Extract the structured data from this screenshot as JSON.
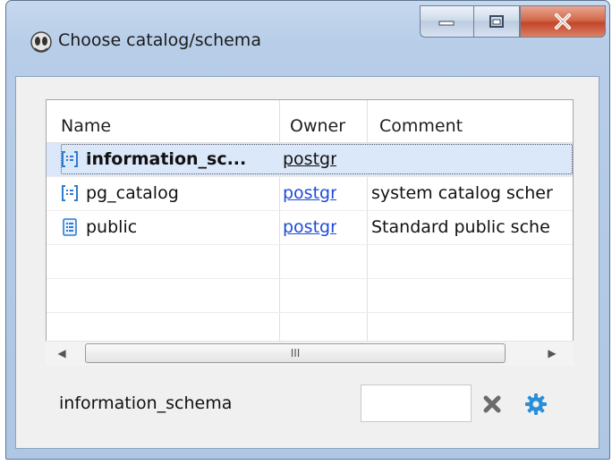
{
  "window": {
    "title": "Choose catalog/schema",
    "controls": {
      "minimize": "minimize",
      "maximize": "maximize",
      "close": "close"
    }
  },
  "table": {
    "columns": [
      "Name",
      "Owner",
      "Comment"
    ],
    "rows": [
      {
        "name": "information_sc...",
        "owner": "postgre:",
        "comment": "",
        "selected": true
      },
      {
        "name": "pg_catalog",
        "owner": "postgre:",
        "comment": "system catalog scher",
        "selected": false
      },
      {
        "name": "public",
        "owner": "postgre:",
        "comment": "Standard public sche",
        "selected": false
      }
    ],
    "scroll_thumb_label": "III"
  },
  "footer": {
    "selected_schema": "information_schema",
    "input_value": "",
    "clear_icon": "close-x-icon",
    "settings_icon": "gear-icon"
  },
  "colors": {
    "link": "#1f4cd6",
    "selection": "#dbe8f9",
    "gear": "#2a8fd8",
    "clear": "#6b6b6b"
  }
}
